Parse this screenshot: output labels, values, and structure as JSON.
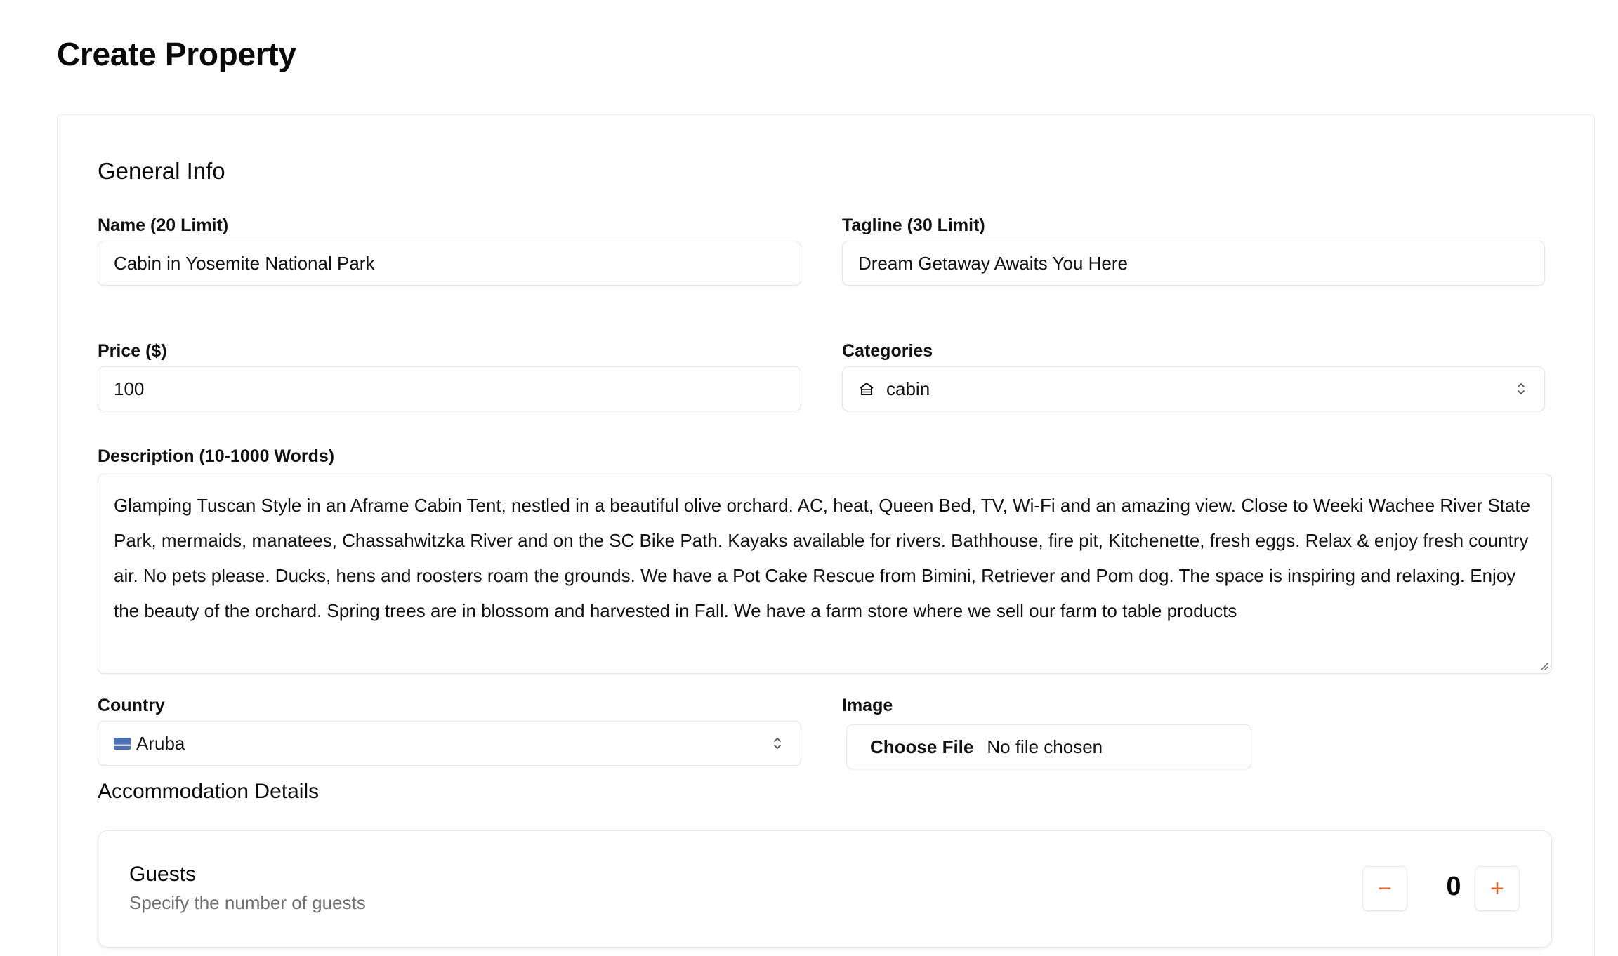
{
  "page": {
    "title": "Create Property"
  },
  "general_info": {
    "heading": "General Info",
    "name": {
      "label": "Name (20 Limit)",
      "value": "Cabin in Yosemite National Park"
    },
    "tagline": {
      "label": "Tagline (30 Limit)",
      "value": "Dream Getaway Awaits You Here"
    },
    "price": {
      "label": "Price ($)",
      "value": "100"
    },
    "categories": {
      "label": "Categories",
      "selected": "cabin",
      "icon": "cabin-icon"
    },
    "description": {
      "label": "Description (10-1000 Words)",
      "value": "Glamping Tuscan Style in an Aframe Cabin Tent, nestled in a beautiful olive orchard. AC, heat, Queen Bed, TV, Wi-Fi and an amazing view. Close to Weeki Wachee River State Park, mermaids, manatees, Chassahwitzka River and on the SC Bike Path. Kayaks available for rivers. Bathhouse, fire pit, Kitchenette, fresh eggs. Relax & enjoy fresh country air. No pets please. Ducks, hens and roosters roam the grounds. We have a Pot Cake Rescue from Bimini, Retriever and Pom dog. The space is inspiring and relaxing. Enjoy the beauty of the orchard. Spring trees are in blossom and harvested in Fall. We have a farm store where we sell our farm to table products"
    },
    "country": {
      "label": "Country",
      "selected": "Aruba",
      "icon": "aruba-flag-icon"
    },
    "image": {
      "label": "Image",
      "button_label": "Choose File",
      "status": "No file chosen"
    }
  },
  "accommodation": {
    "heading": "Accommodation Details",
    "guests": {
      "title": "Guests",
      "subtitle": "Specify the number of guests",
      "value": "0",
      "decrement_label": "−",
      "increment_label": "+"
    }
  },
  "colors": {
    "accent": "#e0662d",
    "border": "#e6e6e8",
    "muted_text": "#6f6f6f"
  }
}
